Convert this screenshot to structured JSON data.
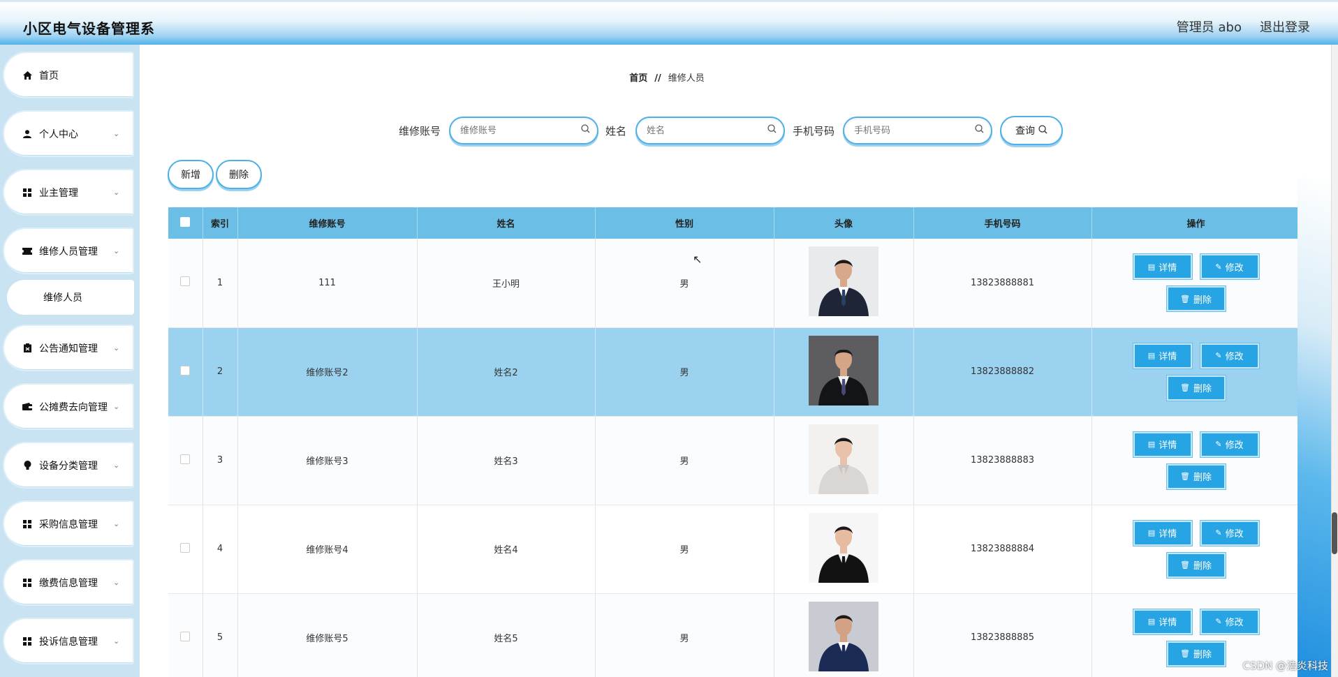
{
  "header": {
    "title": "小区电气设备管理系",
    "user": "管理员 abo",
    "logout": "退出登录"
  },
  "sidebar": {
    "items": [
      {
        "label": "首页",
        "icon": "home-icon",
        "chevron": false
      },
      {
        "label": "个人中心",
        "icon": "person-icon",
        "chevron": true
      },
      {
        "label": "业主管理",
        "icon": "grid-icon",
        "chevron": true
      },
      {
        "label": "维修人员管理",
        "icon": "ticket-icon",
        "chevron": true
      },
      {
        "label": "公告通知管理",
        "icon": "clipboard-icon",
        "chevron": true
      },
      {
        "label": "公摊费去向管理",
        "icon": "wallet-icon",
        "chevron": true
      },
      {
        "label": "设备分类管理",
        "icon": "bulb-icon",
        "chevron": true
      },
      {
        "label": "采购信息管理",
        "icon": "grid-icon",
        "chevron": true
      },
      {
        "label": "缴费信息管理",
        "icon": "grid-icon",
        "chevron": true
      },
      {
        "label": "投诉信息管理",
        "icon": "grid-icon",
        "chevron": true
      }
    ],
    "sub_item": "维修人员"
  },
  "breadcrumb": {
    "home": "首页",
    "sep": "//",
    "current": "维修人员"
  },
  "search": {
    "account_label": "维修账号",
    "account_placeholder": "维修账号",
    "name_label": "姓名",
    "name_placeholder": "姓名",
    "phone_label": "手机号码",
    "phone_placeholder": "手机号码",
    "query_label": "查询"
  },
  "toolbar": {
    "add_label": "新增",
    "delete_label": "删除"
  },
  "table": {
    "columns": [
      "索引",
      "维修账号",
      "姓名",
      "性别",
      "头像",
      "手机号码",
      "操作"
    ],
    "rows": [
      {
        "index": "1",
        "account": "111",
        "name": "王小明",
        "gender": "男",
        "phone": "13823888881"
      },
      {
        "index": "2",
        "account": "维修账号2",
        "name": "姓名2",
        "gender": "男",
        "phone": "13823888882"
      },
      {
        "index": "3",
        "account": "维修账号3",
        "name": "姓名3",
        "gender": "男",
        "phone": "13823888883"
      },
      {
        "index": "4",
        "account": "维修账号4",
        "name": "姓名4",
        "gender": "男",
        "phone": "13823888884"
      },
      {
        "index": "5",
        "account": "维修账号5",
        "name": "姓名5",
        "gender": "男",
        "phone": "13823888885"
      }
    ],
    "actions": {
      "detail": "详情",
      "edit": "修改",
      "delete": "删除"
    }
  },
  "watermark": "CSDN @浩炎科技",
  "colors": {
    "accent": "#27a4e4",
    "header_th": "#6bbee6",
    "selected_row": "#9ad2ef",
    "sidebar_bg": "#c9e3f2"
  }
}
